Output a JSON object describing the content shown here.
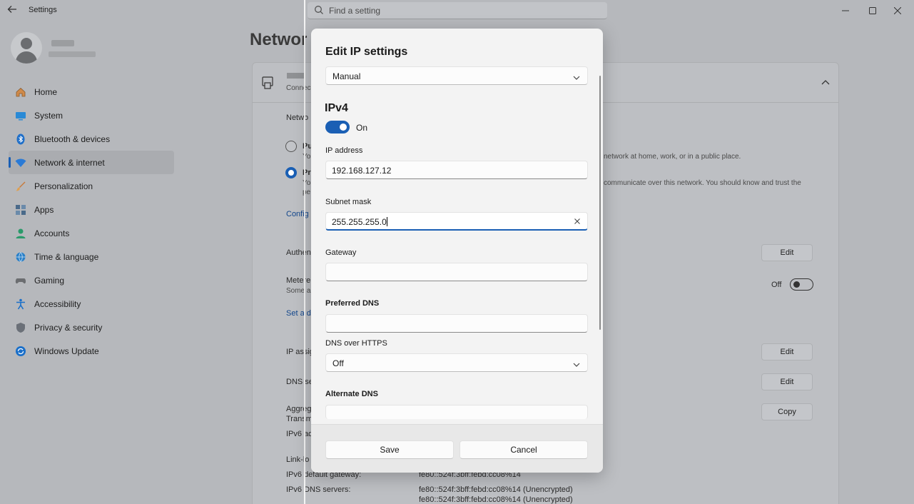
{
  "window": {
    "title": "Settings",
    "search_placeholder": "Find a setting"
  },
  "nav": {
    "items": [
      {
        "label": "Home",
        "icon": "home-icon"
      },
      {
        "label": "System",
        "icon": "system-icon"
      },
      {
        "label": "Bluetooth & devices",
        "icon": "bluetooth-icon"
      },
      {
        "label": "Network & internet",
        "icon": "wifi-icon",
        "active": true
      },
      {
        "label": "Personalization",
        "icon": "brush-icon"
      },
      {
        "label": "Apps",
        "icon": "apps-icon"
      },
      {
        "label": "Accounts",
        "icon": "accounts-icon"
      },
      {
        "label": "Time & language",
        "icon": "globe-icon"
      },
      {
        "label": "Gaming",
        "icon": "gamepad-icon"
      },
      {
        "label": "Accessibility",
        "icon": "accessibility-icon"
      },
      {
        "label": "Privacy & security",
        "icon": "shield-icon"
      },
      {
        "label": "Windows Update",
        "icon": "update-icon"
      }
    ]
  },
  "background": {
    "page_title": "Network",
    "connected": "Connec",
    "network_profile": "Netwo",
    "public_label": "Pu",
    "public_desc_a": "Yo",
    "public_desc_tail": "network at home, work, or in a public place.",
    "private_label": "Pr",
    "private_desc_a": "Yo",
    "private_desc_b": "pe",
    "private_desc_tail": "communicate over this network. You should know and trust the",
    "configure": "Config",
    "auth": "Authen",
    "metered": "Metere",
    "metered_desc": "Some a",
    "metered_state": "Off",
    "set_data": "Set a d",
    "ip_assign": "IP assig",
    "dns_server": "DNS se",
    "aggregated": "Aggreg",
    "transmit": "Transm",
    "ipv6": "IPv6 ad",
    "link_local": "Link-lo",
    "ipv6_gateway_label": "IPv6 default gateway:",
    "ipv6_gateway_value": "fe80::524f:3bff:febd:cc08%14",
    "ipv6_dns_label": "IPv6 DNS servers:",
    "ipv6_dns_value1": "fe80::524f:3bff:febd:cc08%14 (Unencrypted)",
    "ipv6_dns_value2": "fe80::524f:3bff:febd:cc08%14 (Unencrypted)",
    "edit_label": "Edit",
    "copy_label": "Copy"
  },
  "dialog": {
    "title": "Edit IP settings",
    "mode": "Manual",
    "section": "IPv4",
    "toggle_state": "On",
    "ip_label": "IP address",
    "ip_value": "192.168.127.12",
    "subnet_label": "Subnet mask",
    "subnet_value": "255.255.255.0",
    "gateway_label": "Gateway",
    "gateway_value": "",
    "pref_dns_label": "Preferred DNS",
    "pref_dns_value": "",
    "doh_label": "DNS over HTTPS",
    "doh_value": "Off",
    "alt_dns_label": "Alternate DNS",
    "save": "Save",
    "cancel": "Cancel"
  },
  "colors": {
    "accent": "#1a5fb4",
    "overlay_bg": "#b6b8bc",
    "dialog_bg": "#f3f3f3"
  }
}
